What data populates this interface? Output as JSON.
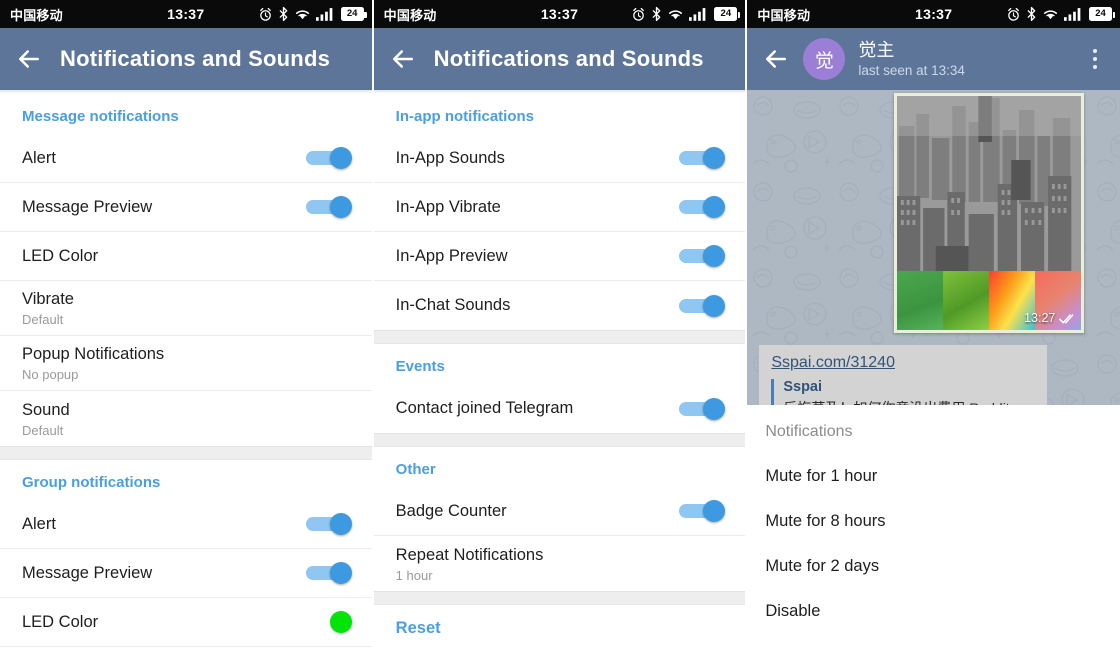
{
  "statusbar": {
    "carrier": "中国移动",
    "time": "13:37",
    "battery_level": "24",
    "icons": [
      "alarm-clock-icon",
      "bluetooth-icon",
      "wifi-icon",
      "signal-bars-icon",
      "battery-icon"
    ]
  },
  "panel1": {
    "appbar": {
      "title": "Notifications and Sounds",
      "back_icon": "back-arrow-icon"
    },
    "sections": [
      {
        "header": "Message notifications",
        "rows": [
          {
            "title": "Alert",
            "sub": "",
            "control": "toggle",
            "on": true
          },
          {
            "title": "Message Preview",
            "sub": "",
            "control": "toggle",
            "on": true
          },
          {
            "title": "LED Color",
            "sub": "",
            "control": "none"
          },
          {
            "title": "Vibrate",
            "sub": "Default",
            "control": "none"
          },
          {
            "title": "Popup Notifications",
            "sub": "No popup",
            "control": "none"
          },
          {
            "title": "Sound",
            "sub": "Default",
            "control": "none"
          }
        ]
      },
      {
        "header": "Group notifications",
        "rows": [
          {
            "title": "Alert",
            "sub": "",
            "control": "toggle",
            "on": true
          },
          {
            "title": "Message Preview",
            "sub": "",
            "control": "toggle",
            "on": true
          },
          {
            "title": "LED Color",
            "sub": "",
            "control": "led",
            "led_color": "#00e408"
          }
        ]
      }
    ]
  },
  "panel2": {
    "appbar": {
      "title": "Notifications and Sounds",
      "back_icon": "back-arrow-icon"
    },
    "sections": [
      {
        "header": "In-app notifications",
        "rows": [
          {
            "title": "In-App Sounds",
            "sub": "",
            "control": "toggle",
            "on": true
          },
          {
            "title": "In-App Vibrate",
            "sub": "",
            "control": "toggle",
            "on": true
          },
          {
            "title": "In-App Preview",
            "sub": "",
            "control": "toggle",
            "on": true
          },
          {
            "title": "In-Chat Sounds",
            "sub": "",
            "control": "toggle",
            "on": true
          }
        ]
      },
      {
        "header": "Events",
        "rows": [
          {
            "title": "Contact joined Telegram",
            "sub": "",
            "control": "toggle",
            "on": true
          }
        ]
      },
      {
        "header": "Other",
        "rows": [
          {
            "title": "Badge Counter",
            "sub": "",
            "control": "toggle",
            "on": true
          },
          {
            "title": "Repeat Notifications",
            "sub": "1 hour",
            "control": "none"
          }
        ]
      },
      {
        "header": "",
        "rows": [
          {
            "title": "Reset",
            "sub": "",
            "control": "link"
          }
        ]
      }
    ]
  },
  "panel3": {
    "appbar": {
      "back_icon": "back-arrow-icon",
      "avatar_letter": "觉",
      "name": "觉主",
      "status": "last seen at 13:34",
      "overflow_icon": "overflow-menu-icon"
    },
    "message": {
      "time": "13:27",
      "ticks_icon": "double-check-icon"
    },
    "link_preview": {
      "url": "Sspai.com/31240",
      "site": "Sspai",
      "desc": "后悔莫及！如何你竟没出费用 Reddit"
    },
    "sheet": {
      "title": "Notifications",
      "items": [
        "Mute for 1 hour",
        "Mute for 8 hours",
        "Mute for 2 days",
        "Disable"
      ]
    }
  },
  "colors": {
    "appbar": "#5c7599",
    "accent_blue": "#4a9fe0",
    "toggle_track": "#8fc6f2",
    "toggle_thumb": "#3d9ae0",
    "led_green": "#00e408",
    "avatar_purple": "#9b7fd6",
    "section_gap": "#eeeeee"
  }
}
